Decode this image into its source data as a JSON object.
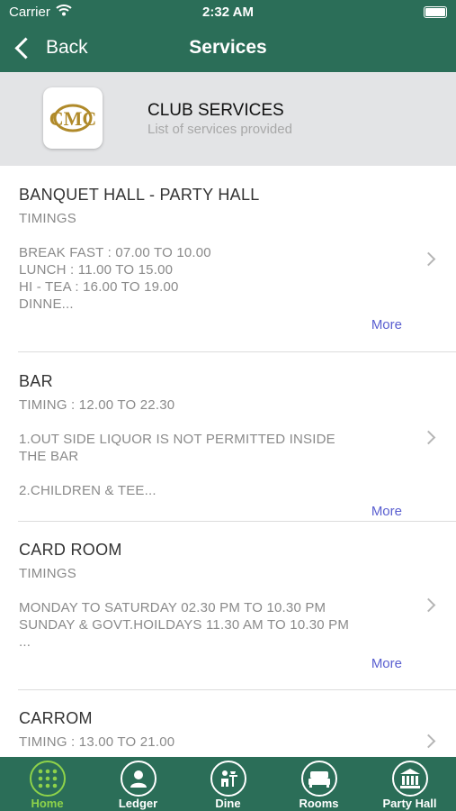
{
  "status_bar": {
    "carrier": "Carrier",
    "time": "2:32 AM"
  },
  "nav": {
    "back_label": "Back",
    "title": "Services"
  },
  "club": {
    "title": "CLUB SERVICES",
    "subtitle": "List of services provided",
    "logo_letters": "CMC"
  },
  "services": [
    {
      "title": "BANQUET HALL - PARTY HALL",
      "lines": [
        "TIMINGS",
        "BREAK FAST : 07.00 TO 10.00",
        "LUNCH : 11.00 TO 15.00",
        "HI - TEA : 16.00 TO 19.00",
        "DINNE..."
      ],
      "more": "More"
    },
    {
      "title": "BAR",
      "lines": [
        "TIMING : 12.00 TO 22.30",
        "1.OUT SIDE LIQUOR IS NOT PERMITTED INSIDE",
        "THE BAR",
        "2.CHILDREN & TEE..."
      ],
      "more": "More"
    },
    {
      "title": "CARD ROOM",
      "lines": [
        "TIMINGS",
        "MONDAY TO SATURDAY 02.30 PM TO 10.30 PM",
        "SUNDAY & GOVT.HOILDAYS 11.30 AM TO 10.30 PM",
        "..."
      ],
      "more": "More"
    },
    {
      "title": "CARROM",
      "lines": [
        "TIMING : 13.00 TO 21.00"
      ]
    }
  ],
  "tabs": [
    {
      "label": "Home",
      "icon": "grid-icon",
      "active": true
    },
    {
      "label": "Ledger",
      "icon": "person-icon",
      "active": false
    },
    {
      "label": "Dine",
      "icon": "dine-icon",
      "active": false
    },
    {
      "label": "Rooms",
      "icon": "bed-icon",
      "active": false
    },
    {
      "label": "Party Hall",
      "icon": "bank-icon",
      "active": false
    }
  ],
  "colors": {
    "primary": "#2b6e58",
    "active_tab": "#8ed24a",
    "link": "#5a5fd0",
    "header_band": "#e3e4e6",
    "logo": "#b08a2a"
  }
}
